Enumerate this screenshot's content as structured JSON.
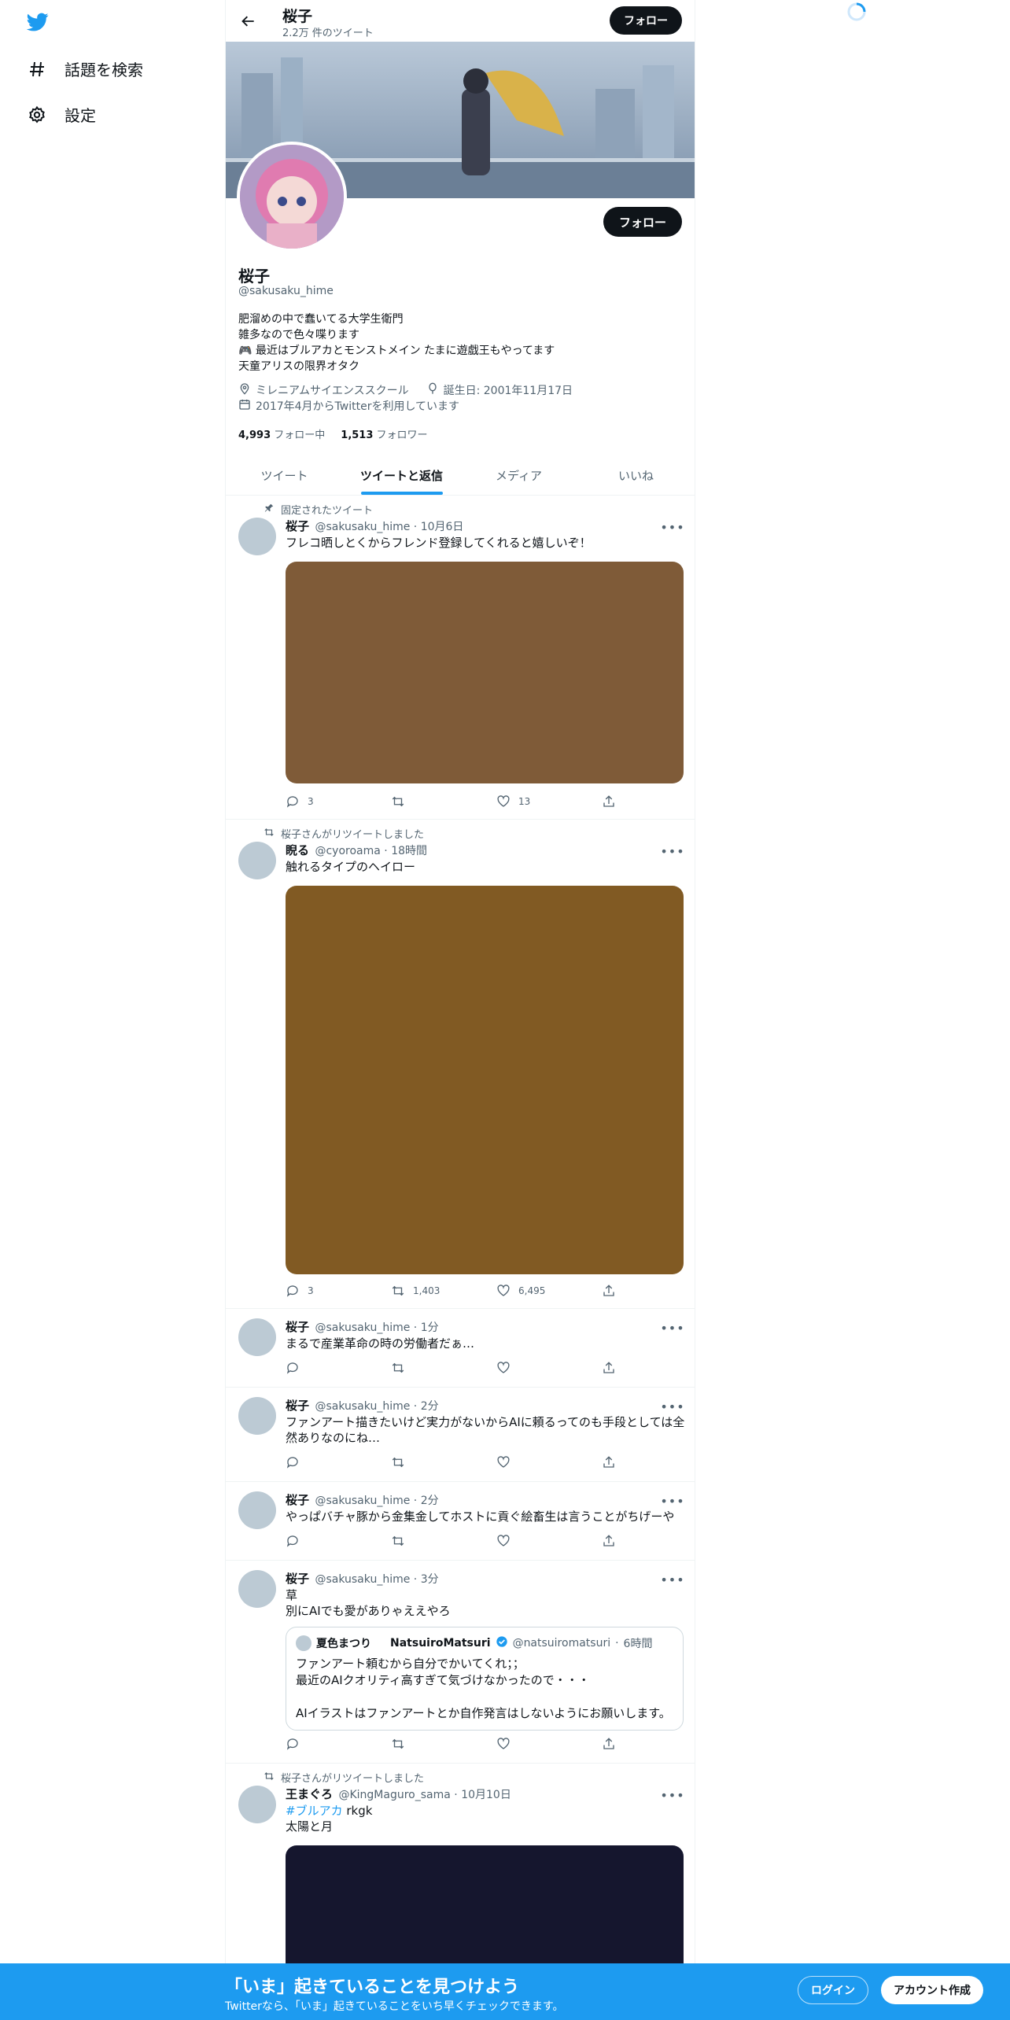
{
  "nav": {
    "explore_label": "話題を検索",
    "settings_label": "設定",
    "logo_icon": "twitter-bird-icon",
    "brand_color": "#1d9bf0"
  },
  "header": {
    "name": "桜子",
    "tweet_count": "2.2万 件のツイート",
    "follow_label": "フォロー"
  },
  "profile": {
    "follow_label": "フォロー",
    "name": "桜子",
    "handle": "@sakusaku_hime",
    "bio": [
      "肥溜めの中で蠢いてる大学生衛門",
      "雑多なので色々喋ります",
      "🎮 最近はブルアカとモンストメイン たまに遊戯王もやってます",
      "天童アリスの限界オタク"
    ],
    "location": "ミレニアムサイエンススクール",
    "birthday": "誕生日: 2001年11月17日",
    "joined": "2017年4月からTwitterを利用しています",
    "following_count": "4,993",
    "following_label": "フォロー中",
    "followers_count": "1,513",
    "followers_label": "フォロワー"
  },
  "tabs": [
    "ツイート",
    "ツイートと返信",
    "メディア",
    "いいね"
  ],
  "active_tab": "ツイートと返信",
  "tweets": [
    {
      "context": "固定されたツイート",
      "name": "桜子",
      "handle": "@sakusaku_hime",
      "time": "10月6日",
      "text": "フレコ晒しとくからフレンド登録してくれると嬉しいぞ！",
      "media_color": "#7f5b38",
      "replies": "3",
      "retweets": "",
      "likes": "13"
    },
    {
      "context": "桜子さんがリツイートしました",
      "name": "睨る",
      "handle": "@cyoroama",
      "time": "18時間",
      "text": "触れるタイプのヘイロー",
      "media_color": "#815a23",
      "replies": "3",
      "retweets": "1,403",
      "likes": "6,495"
    },
    {
      "name": "桜子",
      "handle": "@sakusaku_hime",
      "time": "1分",
      "text": "まるで産業革命の時の労働者だぁ…"
    },
    {
      "name": "桜子",
      "handle": "@sakusaku_hime",
      "time": "2分",
      "text": "ファンアート描きたいけど実力がないからAIに頼るってのも手段としては全然ありなのにね…"
    },
    {
      "name": "桜子",
      "handle": "@sakusaku_hime",
      "time": "2分",
      "text": "やっぱバチャ豚から金集金してホストに貢ぐ絵畜生は言うことがちげーや"
    },
    {
      "name": "桜子",
      "handle": "@sakusaku_hime",
      "time": "3分",
      "text_lines": [
        "草",
        "別にAIでも愛がありゃええやろ"
      ],
      "quote": {
        "name": "夏色まつり",
        "name2": "NatsuiroMatsuri",
        "handle": "@natsuiromatsuri",
        "time": "6時間",
        "lines": [
          "ファンアート頼むから自分でかいてくれ；；",
          "最近のAIクオリティ高すぎて気づけなかったので・・・",
          "",
          "AIイラストはファンアートとか自作発言はしないようにお願いします。"
        ]
      }
    },
    {
      "context": "桜子さんがリツイートしました",
      "name": "王まぐろ",
      "handle": "@KingMaguro_sama",
      "time": "10月10日",
      "hashtag": "#ブルアカ",
      "hashtag_rest": " rkgk",
      "line2": "太陽と月",
      "media_color": "#15162e"
    }
  ],
  "bottom": {
    "title": "「いま」起きていることを見つけよう",
    "subtitle": "Twitterなら、「いま」起きていることをいち早くチェックできます。",
    "login_label": "ログイン",
    "signup_label": "アカウント作成"
  }
}
